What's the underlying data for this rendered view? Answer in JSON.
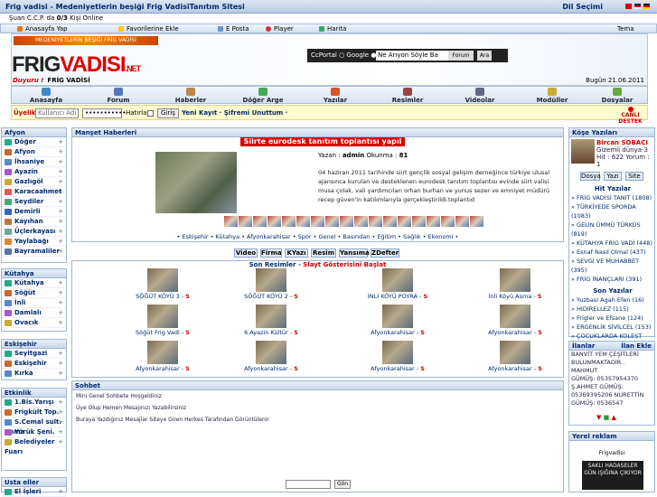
{
  "title": "Frig vadisi - Medeniyetlerin beşiği Frig VadisiTanıtım Sitesi",
  "dil_secimi": "Dil Seçimi",
  "online": {
    "prefix": "Şuan C.C.P. da",
    "count": "0/3",
    "suffix": "Kişi Online"
  },
  "tools": {
    "home": "Anasayfa Yap",
    "fav": "Favorilerine Ekle",
    "email": "E Posta",
    "player": "Player",
    "map": "Harita",
    "tema": "Tema"
  },
  "banner": {
    "logo_a": "FRIG",
    "logo_b": "VADISI",
    "logo_c": ".NET",
    "strip": "MEDENİYETLERİN BEŞİĞİ FRİG VADİSİ"
  },
  "search": {
    "ccportal": "CcPortal",
    "google": "Google",
    "placeholder": "Ne Arıyon Söyle Ba",
    "forum": "Forum",
    "button": "Ara"
  },
  "duyuru": {
    "label": "Duyuru !",
    "text": "FRİG VADİSİ",
    "date": "Bugün 21.06.2011"
  },
  "nav": [
    "Anasayfa",
    "Forum",
    "Haberler",
    "Döğer Arge",
    "Yazılar",
    "Resimler",
    "Videolar",
    "Modüller",
    "Dosyalar"
  ],
  "login": {
    "label": "Üyelik",
    "user_placeholder": "Kullanıcı Adı",
    "pass": "•••••••••••",
    "remember": "Hatırla",
    "submit": "Giriş",
    "links": "Yeni Kayıt · Şifremi Unuttum ·",
    "destek": "CANLI DESTEK"
  },
  "left": {
    "afyon": {
      "title": "Afyon",
      "items": [
        "Döğer",
        "Afyon",
        "İhsaniye",
        "Ayazin",
        "Gazlıgöl",
        "Karacaahmet",
        "Seydiler",
        "Demirli",
        "Kayıhan",
        "Üçlerkayası",
        "Yaylabağı",
        "Bayramaliler"
      ]
    },
    "kutahya": {
      "title": "Kütahya",
      "items": [
        "Kütahya",
        "Söğüt",
        "İnli",
        "Damlalı",
        "Ovacık"
      ]
    },
    "eskisehir": {
      "title": "Eskişehir",
      "items": [
        "Seyitgazi",
        "Eskişehir",
        "Kırka"
      ]
    },
    "etkinlik": {
      "title": "Etkinlik",
      "items": [
        "1.Bis.Yarışı",
        "Frigkült Top.",
        "S.Cemal sult. Anma",
        "Yörük Şeni.",
        "Belediyeler Fuarı"
      ]
    },
    "usta": {
      "title": "Usta eller",
      "items": [
        "El İşleri"
      ]
    }
  },
  "center": {
    "manset_title": "Manşet Haberleri",
    "headline": "Siirte eurodesk tanıtım toplantısı yapıl",
    "author_label": "Yazan :",
    "author": "admin",
    "okunma_label": "Okunma :",
    "okunma": "81",
    "text": "04 haziran 2011 tarihinde siirt gençlik sosyal gelişim derneğince türkiye ulusal ajansınca kurulan ve desteklenen eurodesk tanıtım toplantısı evinde siirt valisi musa çolak, vali yardımcıları orhan burhan ve yunus sezer ve emniyet müdürü recep güven'in katılımlarıyla gerçekleştirildi.toplantıd",
    "tags": "• Eskişehir • Kütahya • Afyonkarahisar • Spor • Genel • Basından • Eğitim • Sağlık • Ekonomi •",
    "tabs": [
      "Video",
      "Firma",
      "KYazı",
      "Resim",
      "Yansıma",
      "ZDefter"
    ],
    "son_resimler": "Son Resimler",
    "slayt": "Slayt Gösterisini Başlat",
    "gallery": [
      {
        "cap": "SÖĞÜT KÖYÜ 3",
        "s": "S"
      },
      {
        "cap": "SÖĞÜT KÖYÜ 2",
        "s": "S"
      },
      {
        "cap": "İNLİ KÖYÜ POYRA",
        "s": "S"
      },
      {
        "cap": "İnli Köyü Asma",
        "s": "S"
      },
      {
        "cap": "Söğüt Frig Vadi",
        "s": "S"
      },
      {
        "cap": "6.Ayazin Kültür",
        "s": "S"
      },
      {
        "cap": "Afyonkarahisar",
        "s": "S"
      },
      {
        "cap": "Afyonkarahisar",
        "s": "S"
      },
      {
        "cap": "Afyonkarahisar",
        "s": "S"
      },
      {
        "cap": "Afyonkarahisar",
        "s": "S"
      },
      {
        "cap": "Afyonkarahisar",
        "s": "S"
      },
      {
        "cap": "Afyonkarahisar",
        "s": "S"
      }
    ],
    "sohbet_title": "Sohbet",
    "sohbet_msgs": [
      "Mini Genel Sohbete Hoşgeldiniz",
      "Üye Olup Hemen Mesajınızı Yazabilirsiniz",
      "Buraya Yazdığınız Mesajlar Siteye Giren Herkes Tarafından Görüntülenir"
    ],
    "sohbet_button": "Gön"
  },
  "right": {
    "kose_title": "Köşe Yazıları",
    "author": "Bircan SOBACI",
    "gizemli": "Gizemli dünya-3",
    "hit": "Hit : 622 Yorum : 1",
    "kbtn": [
      "Dosya",
      "Yazı",
      "Site"
    ],
    "hit_title": "Hit Yazılar",
    "hit_items": [
      "FRİG VADİSİ TANIT (1808)",
      "TÜRKİYEDE SPORDA (1083)",
      "GELİN ÜMMÜ TÜRKÜS (819)",
      "KÜTAHYA FRİG VADİ (448)",
      "Esnaf Nasıl Olmal (437)",
      "SEVGİ VE MUHABBET (395)",
      "FRİG İNANÇLARI (391)"
    ],
    "son_title": "Son Yazılar",
    "son_items": [
      "Yuzbasi Agah Efen (16)",
      "HIDIRELLEZ (115)",
      "Frigler ve Efsane (124)",
      "ERGENLİK SİVİLCEL (153)",
      "ÇOCUKLARDA KOLEST (154)",
      "Sigara, Girtl (135)",
      "LAZER İLE 10 DAKİ (204)"
    ],
    "ilan_title": "İlanlar",
    "ilan_ekle": "İlan Ekle",
    "ilan_text": [
      "BANVİT YEM ÇEŞİTLERİ",
      "BULUNMAKTADIR.. MAHMUT",
      "GÜMÜŞ: 05357954370",
      "Ş.AHMET GÜMÜŞ:",
      "05369395206 NURETTİN",
      "GÜMÜŞ: 0536547"
    ],
    "reklam_title": "Yerel reklam",
    "reklam_name": "Frigvadisi",
    "reklam_box": "SAKLI HADASELER GÜN IŞIĞINA ÇIKIYOR"
  },
  "colors": {
    "accent": "#002a6a",
    "red": "#d00"
  }
}
